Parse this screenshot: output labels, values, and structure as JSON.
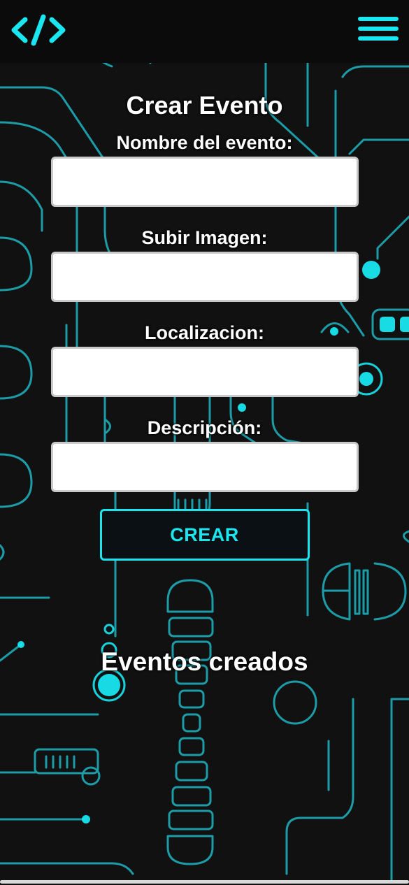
{
  "header": {
    "logo_icon": "code-brackets-icon",
    "menu_icon": "hamburger-menu-icon",
    "accent_color": "#19e6f0"
  },
  "form": {
    "title": "Crear Evento",
    "fields": [
      {
        "label": "Nombre del evento:",
        "value": "",
        "placeholder": ""
      },
      {
        "label": "Subir Imagen:",
        "value": "",
        "placeholder": ""
      },
      {
        "label": "Localizacion:",
        "value": "",
        "placeholder": ""
      },
      {
        "label": "Descripción:",
        "value": "",
        "placeholder": ""
      }
    ],
    "submit_label": "CREAR"
  },
  "created": {
    "title": "Eventos creados"
  }
}
